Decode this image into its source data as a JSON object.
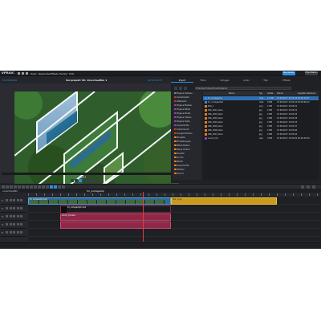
{
  "app": {
    "logo": "VPR4IC"
  },
  "menu": {
    "items": [
      "Datei",
      "Bearbeiten",
      "Effekte",
      "Fenster",
      "Hilfe"
    ],
    "modes": [
      {
        "label": "Bearbeiten",
        "color": "#2d8fe0"
      },
      {
        "label": "Exportieren",
        "color": "#3a3e46"
      }
    ]
  },
  "monitor": {
    "timecode_left": "00:00:00:00",
    "title": "Vorprojekt: Mr. Vorschaufilm 1",
    "timecode_right": "00:00:12:07",
    "scrub_timecode": "2:07"
  },
  "pool": {
    "tabs": [
      {
        "label": "Import",
        "active": true
      },
      {
        "label": "Filme",
        "active": false
      },
      {
        "label": "Vorlagen",
        "active": false
      },
      {
        "label": "Audio",
        "active": false
      },
      {
        "label": "Titel",
        "active": false
      },
      {
        "label": "Effekte",
        "active": false
      }
    ],
    "path": "C:\\Nutzer\\Videos\\Projektmaterial",
    "tree": [
      {
        "label": "Eigene Dateien",
        "color": "#7a7f88"
      },
      {
        "label": "Arbeitsplatz",
        "color": "#c0392b"
      },
      {
        "label": "Netzwerk",
        "color": "#c0392b"
      },
      {
        "label": "Eigene Medien",
        "color": "#8e44ad"
      },
      {
        "label": "Eigene Bilder",
        "color": "#8e44ad"
      },
      {
        "label": "Eigene Musik",
        "color": "#8e44ad"
      },
      {
        "label": "Eigene Videos",
        "color": "#8e44ad"
      },
      {
        "label": "Eigene Texte",
        "color": "#8e44ad"
      },
      {
        "label": "Ausschnitte",
        "color": "#8e44ad"
      },
      {
        "label": "Dokumente",
        "color": "#c0392b"
      },
      {
        "label": "Google Medien",
        "color": "#c0392b"
      },
      {
        "label": "Projekte",
        "color": "#e67e22"
      },
      {
        "label": "Einstellungen",
        "color": "#e67e22"
      },
      {
        "label": "Bibliotheken",
        "color": "#e67e22"
      },
      {
        "label": "Neue Ordner",
        "color": "#e67e22"
      },
      {
        "label": "Zuletzt",
        "color": "#e67e22"
      },
      {
        "label": "Archiv",
        "color": "#e67e22"
      },
      {
        "label": "Bilder",
        "color": "#e67e22"
      },
      {
        "label": "Ausschnitte",
        "color": "#e67e22"
      },
      {
        "label": "Medien",
        "color": "#e67e22"
      },
      {
        "label": "Sound",
        "color": "#e67e22"
      }
    ],
    "columns": [
      "Name",
      "Typ",
      "Größe",
      "Datum",
      "Längster Zeitraum"
    ],
    "files": [
      {
        "name": "ihr_vorlageclip",
        "type": "mp4",
        "size": "12 MB",
        "date": "07.08.2017 15:04:43",
        "extra": "00:00:12:07",
        "selected": true
      },
      {
        "name": "ihr_vorlageclip2",
        "type": "mp4",
        "size": "9 MB",
        "date": "07.08.2017 15:04:43",
        "extra": "00:00:08:12",
        "selected": false
      },
      {
        "name": "titel_1",
        "type": "png",
        "size": "1 MB",
        "date": "07.08.2017 15:05:10",
        "extra": "",
        "selected": false
      },
      {
        "name": "IMG_0201_klein",
        "type": "jpg",
        "size": "2 MB",
        "date": "07.08.2017 15:05:21",
        "extra": "",
        "selected": false
      },
      {
        "name": "IMG_0202_klein",
        "type": "jpg",
        "size": "2 MB",
        "date": "07.08.2017 15:05:24",
        "extra": "",
        "selected": false
      },
      {
        "name": "IMG_0203_klein",
        "type": "jpg",
        "size": "2 MB",
        "date": "07.08.2017 15:05:28",
        "extra": "",
        "selected": false
      },
      {
        "name": "IMG_0204_klein",
        "type": "jpg",
        "size": "2 MB",
        "date": "07.08.2017 15:05:33",
        "extra": "",
        "selected": false
      },
      {
        "name": "IMG_0205_klein",
        "type": "jpg",
        "size": "2 MB",
        "date": "07.08.2017 15:05:37",
        "extra": "",
        "selected": false
      },
      {
        "name": "IMG_0206_klein",
        "type": "jpg",
        "size": "2 MB",
        "date": "07.08.2017 15:05:40",
        "extra": "",
        "selected": false
      },
      {
        "name": "IMG_0207_klein",
        "type": "jpg",
        "size": "2 MB",
        "date": "07.08.2017 15:05:44",
        "extra": "",
        "selected": false
      },
      {
        "name": "sound_mix",
        "type": "wav",
        "size": "4 MB",
        "date": "07.08.2017 15:06:02",
        "extra": "00:00:30:00",
        "selected": false
      }
    ]
  },
  "timeline": {
    "tabs": [
      "vorschaufilm",
      "ihr_vorlageclip"
    ],
    "tracks": [
      {
        "name": "1",
        "clip_label": "ihr_vorlageclip.mp4"
      },
      {
        "name": "2",
        "clip_label": "titel_1.png"
      },
      {
        "name": "3",
        "clip_label": "ihr_vorlageclip2.mp4"
      },
      {
        "name": "4",
        "clip_label": "sound_mix.wav"
      },
      {
        "name": "5",
        "clip_label": ""
      }
    ]
  }
}
